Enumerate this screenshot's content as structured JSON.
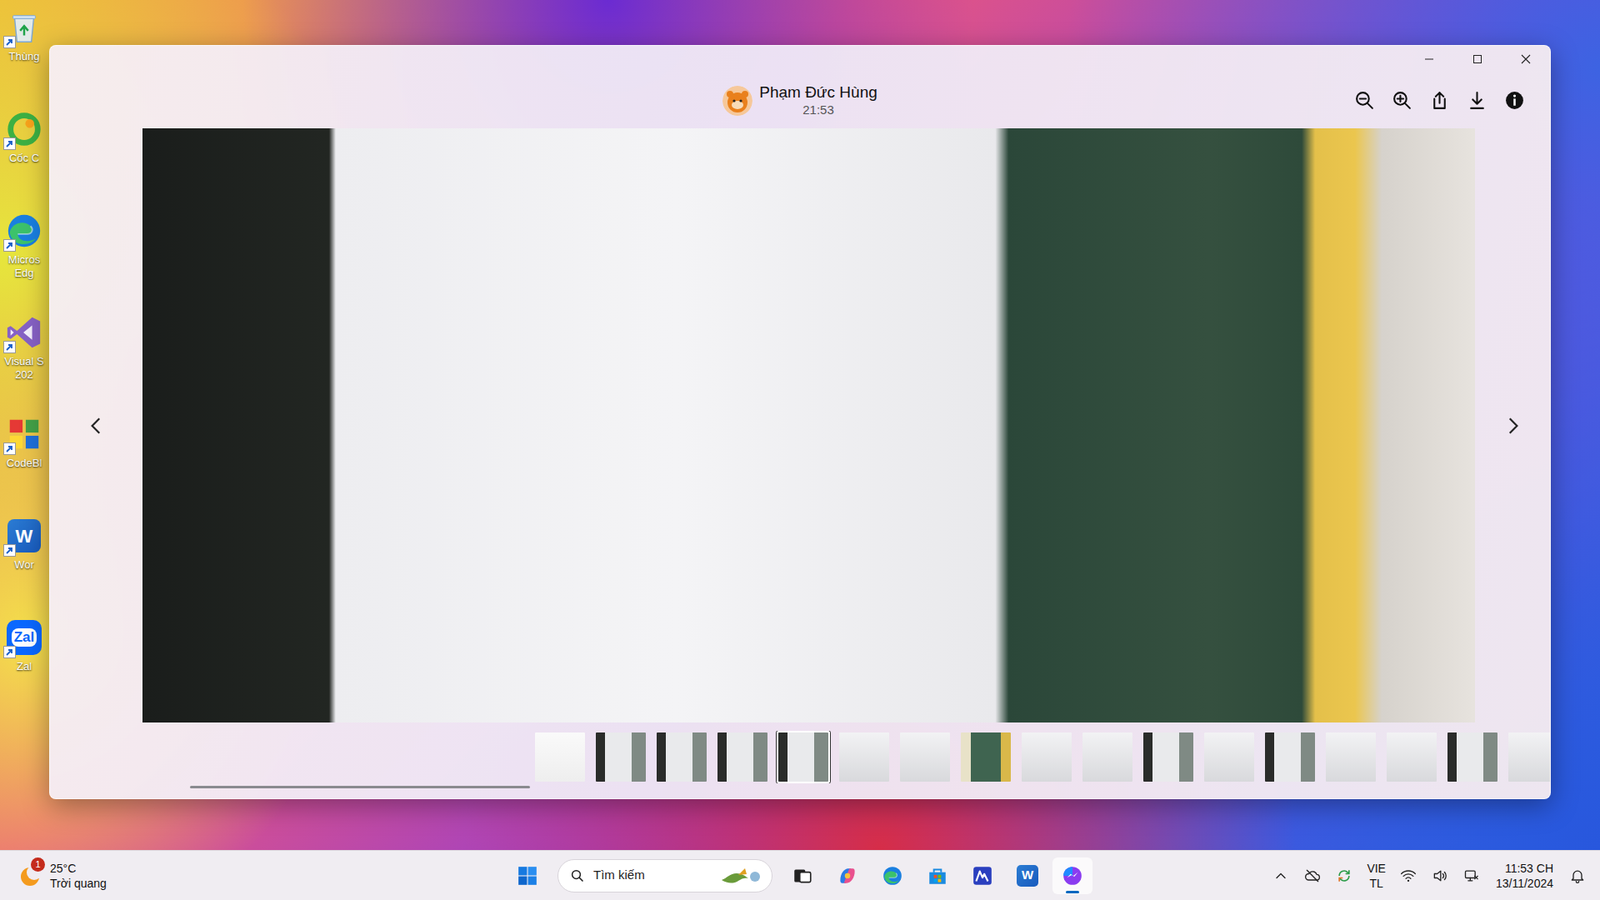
{
  "desktop_icons": [
    {
      "label": "Thùng",
      "kind": "recycle"
    },
    {
      "label": "Cốc C",
      "kind": "coccoc"
    },
    {
      "label": "Micros Edg",
      "kind": "edge"
    },
    {
      "label": "Visual S 202",
      "kind": "vs"
    },
    {
      "label": "CodeBl",
      "kind": "codeblocks"
    },
    {
      "label": "Wor",
      "kind": "word",
      "glyph": "W"
    },
    {
      "label": "Zal",
      "kind": "zalo",
      "glyph": "Zal"
    }
  ],
  "viewer": {
    "sender": "Phạm Đức Hùng",
    "time": "21:53"
  },
  "thumbnails": [
    {
      "kind": "document",
      "selected": false
    },
    {
      "kind": "photo",
      "selected": false
    },
    {
      "kind": "photo",
      "selected": false
    },
    {
      "kind": "photo",
      "selected": false
    },
    {
      "kind": "photo",
      "selected": true
    },
    {
      "kind": "slide",
      "selected": false
    },
    {
      "kind": "slide",
      "selected": false
    },
    {
      "kind": "board",
      "selected": false
    },
    {
      "kind": "slide",
      "selected": false
    },
    {
      "kind": "slide",
      "selected": false
    },
    {
      "kind": "photo",
      "selected": false
    },
    {
      "kind": "slide",
      "selected": false
    },
    {
      "kind": "photo",
      "selected": false
    },
    {
      "kind": "slide",
      "selected": false
    },
    {
      "kind": "slide",
      "selected": false
    },
    {
      "kind": "photo",
      "selected": false
    },
    {
      "kind": "slide",
      "selected": false
    }
  ],
  "thumb_scroll": {
    "level": 0.25
  },
  "taskbar": {
    "weather": {
      "temp": "25°C",
      "condition": "Trời quang",
      "badge": "1"
    },
    "search": {
      "placeholder": "Tìm kiếm"
    },
    "apps": [
      {
        "kind": "taskview",
        "active": false
      },
      {
        "kind": "copilot",
        "active": false
      },
      {
        "kind": "edge",
        "active": false
      },
      {
        "kind": "store",
        "active": false
      },
      {
        "kind": "mathtype",
        "active": false
      },
      {
        "kind": "word",
        "glyph": "W",
        "active": false
      },
      {
        "kind": "messenger",
        "active": true
      }
    ],
    "tray": {
      "language": "VIE",
      "layout": "TL",
      "time": "11:53 CH",
      "date": "13/11/2024"
    }
  }
}
